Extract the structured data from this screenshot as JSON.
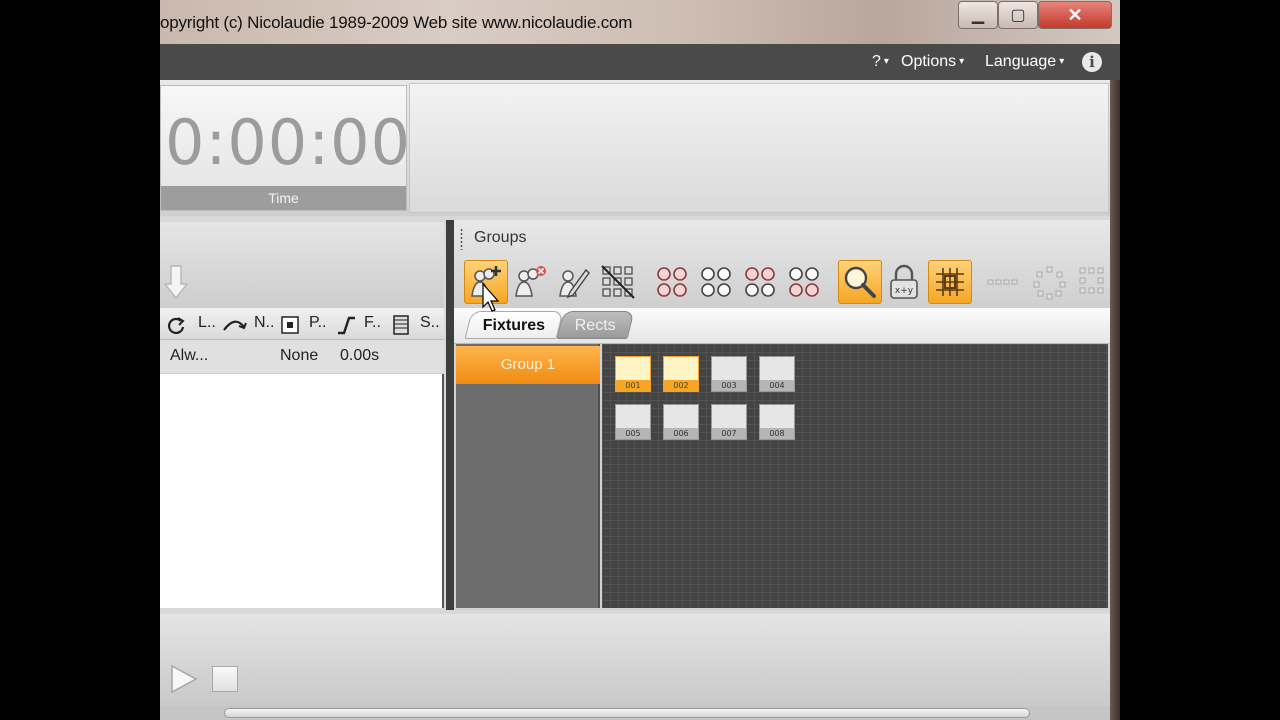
{
  "window": {
    "title": "opyright (c) Nicolaudie 1989-2009    Web site www.nicolaudie.com",
    "buttons": {
      "minimize": "▁",
      "maximize": "▢",
      "close": "✕"
    }
  },
  "menubar": {
    "help": "?",
    "options": "Options",
    "language": "Language",
    "info": "i"
  },
  "time_display": {
    "value": "0:00:00",
    "caption": "Time"
  },
  "steps_table": {
    "columns": [
      {
        "icon": "loop-icon",
        "label": "L.."
      },
      {
        "icon": "next-icon",
        "label": "N.."
      },
      {
        "icon": "port-icon",
        "label": "P.."
      },
      {
        "icon": "fade-icon",
        "label": "F.."
      },
      {
        "icon": "scene-icon",
        "label": "S.."
      }
    ],
    "rows": [
      {
        "loop": "Alw...",
        "next": "None",
        "fade": "0.00s"
      }
    ]
  },
  "groups_panel": {
    "title": "Groups",
    "tabs": {
      "fixtures": "Fixtures",
      "rects": "Rects"
    },
    "groups": [
      "Group 1"
    ],
    "fixtures": [
      {
        "label": "001",
        "selected": true
      },
      {
        "label": "002",
        "selected": true
      },
      {
        "label": "003",
        "selected": false
      },
      {
        "label": "004",
        "selected": false
      },
      {
        "label": "005",
        "selected": false
      },
      {
        "label": "006",
        "selected": false
      },
      {
        "label": "007",
        "selected": false
      },
      {
        "label": "008",
        "selected": false
      }
    ],
    "tools": [
      "add-group-icon",
      "delete-group-icon",
      "rename-group-icon",
      "select-all-icon",
      "circle-arrangement-1-icon",
      "circle-arrangement-2-icon",
      "circle-arrangement-3-icon",
      "circle-arrangement-4-icon",
      "zoom-icon",
      "lock-xy-icon",
      "grid-snap-icon",
      "line-arrangement-icon",
      "circle-arrangement-icon",
      "grid-arrangement-icon"
    ],
    "tool_states": {
      "zoom": "on",
      "grid-snap": "on",
      "add-group": "hover"
    }
  },
  "colors": {
    "accent": "#f5a623",
    "menubar": "#4a4a4a"
  }
}
